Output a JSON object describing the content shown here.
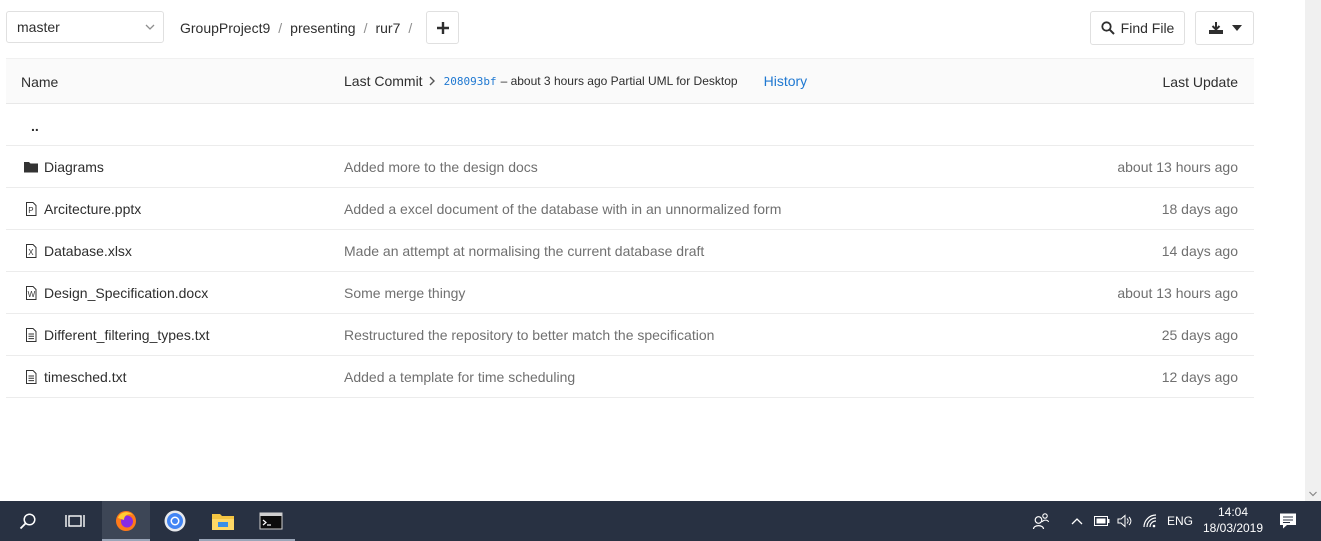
{
  "toolbar": {
    "branch": "master",
    "breadcrumb": [
      "GroupProject9",
      "presenting",
      "rur7"
    ],
    "find_file_label": "Find File"
  },
  "table": {
    "header_name": "Name",
    "header_last_commit": "Last Commit",
    "commit_sha": "208093bf",
    "commit_meta": "– about 3 hours ago Partial UML for Desktop",
    "history_label": "History",
    "header_last_update": "Last Update",
    "parent_dir": "..",
    "rows": [
      {
        "name": "Diagrams",
        "icon": "folder-icon",
        "message": "Added more to the design docs",
        "date": "about 13 hours ago"
      },
      {
        "name": "Arcitecture.pptx",
        "icon": "powerpoint-file-icon",
        "message": "Added a excel document of the database with in an unnormalized form",
        "date": "18 days ago"
      },
      {
        "name": "Database.xlsx",
        "icon": "excel-file-icon",
        "message": "Made an attempt at normalising the current database draft",
        "date": "14 days ago"
      },
      {
        "name": "Design_Specification.docx",
        "icon": "word-file-icon",
        "message": "Some merge thingy",
        "date": "about 13 hours ago"
      },
      {
        "name": "Different_filtering_types.txt",
        "icon": "text-file-icon",
        "message": "Restructured the repository to better match the specification",
        "date": "25 days ago"
      },
      {
        "name": "timesched.txt",
        "icon": "text-file-icon",
        "message": "Added a template for time scheduling",
        "date": "12 days ago"
      }
    ]
  },
  "taskbar": {
    "apps": [
      "search-icon",
      "task-view-icon",
      "firefox-icon",
      "chrome-icon",
      "file-explorer-icon",
      "terminal-icon"
    ],
    "language": "ENG",
    "time": "14:04",
    "date": "18/03/2019"
  },
  "colors": {
    "link": "#1f78d1",
    "taskbar": "#283142",
    "muted_text": "#707070"
  }
}
